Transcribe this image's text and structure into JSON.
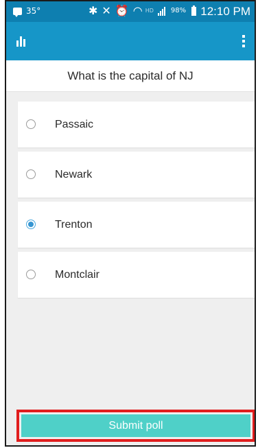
{
  "status_bar": {
    "temperature": "35°",
    "battery_percent": "98%",
    "time": "12:10 PM",
    "icons": [
      "message-icon",
      "bluetooth-icon",
      "mute-icon",
      "alarm-icon",
      "wifi-icon",
      "signal-icon",
      "battery-icon"
    ]
  },
  "app_bar": {
    "logo_icon": "bar-chart-icon",
    "menu_icon": "overflow-menu-icon",
    "color": "#1696c8"
  },
  "question": "What is the capital of NJ",
  "options": [
    {
      "label": "Passaic",
      "selected": false
    },
    {
      "label": "Newark",
      "selected": false
    },
    {
      "label": "Trenton",
      "selected": true
    },
    {
      "label": "Montclair",
      "selected": false
    }
  ],
  "submit": {
    "label": "Submit poll",
    "color": "#4fd0c8",
    "highlight_color": "#e11d1d"
  }
}
